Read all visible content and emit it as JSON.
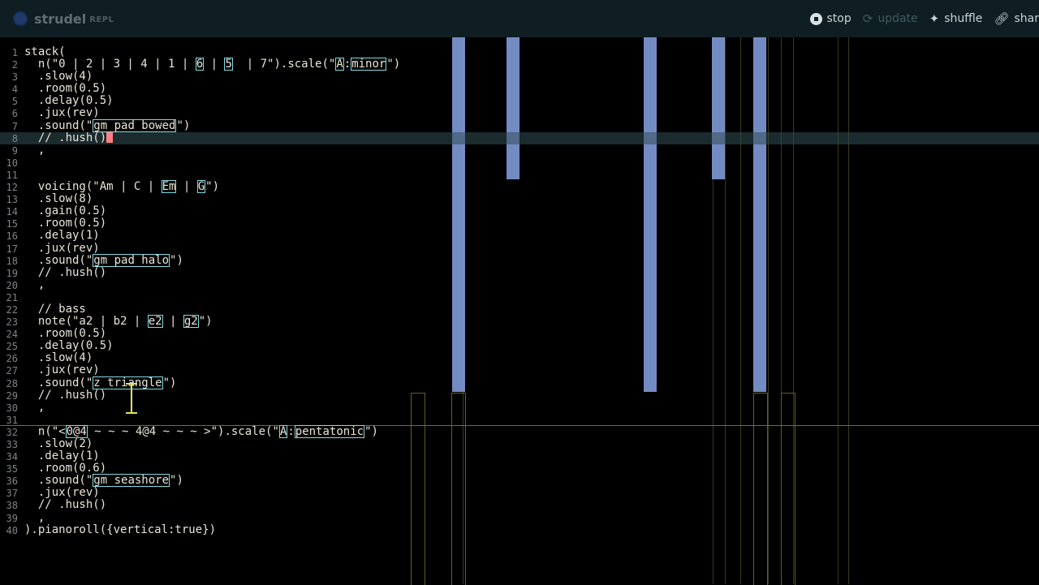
{
  "app": {
    "name": "strudel",
    "sub": "REPL"
  },
  "nav": {
    "stop": "stop",
    "update": "update",
    "shuffle": "shuffle",
    "share": "shar"
  },
  "editor": {
    "active_line": 8,
    "lines": [
      "stack(",
      "  n(\"0 | 2 | 3 | 4 | 1 | 6 | 5  | 7\").scale(\"A:minor\")",
      "  .slow(4)",
      "  .room(0.5)",
      "  .delay(0.5)",
      "  .jux(rev)",
      "  .sound(\"gm_pad_bowed\")",
      "  // .hush()",
      "  ,",
      "",
      "",
      "  voicing(\"Am | C | Em | G\")",
      "  .slow(8)",
      "  .gain(0.5)",
      "  .room(0.5)",
      "  .delay(1)",
      "  .jux(rev)",
      "  .sound(\"gm_pad_halo\")",
      "  // .hush()",
      "  ,",
      "",
      "  // bass",
      "  note(\"a2 | b2 | e2 | g2\")",
      "  .room(0.5)",
      "  .delay(0.5)",
      "  .slow(4)",
      "  .jux(rev)",
      "  .sound(\"z_triangle\")",
      "  // .hush()",
      "  ,",
      "",
      "  n(\"<0@4 ~ ~ ~ 4@4 ~ ~ ~ >\").scale(\"A:pentatonic\")",
      "  .slow(2)",
      "  .delay(1)",
      "  .room(0.6)",
      "  .sound(\"gm_seashore\")",
      "  .jux(rev)",
      "  // .hush()",
      "  ,",
      ").pianoroll({vertical:true})"
    ]
  },
  "colors": {
    "background": "#000000",
    "header": "#0f1e22",
    "highlight": "#7fdde4",
    "note_bar": "#7f9ad8",
    "cursor": "#ff7f86"
  },
  "icons": {
    "logo": "strudel-logo-icon",
    "stop": "stop-circle-icon",
    "update": "refresh-icon",
    "shuffle": "sparkle-icon",
    "share": "link-icon"
  }
}
